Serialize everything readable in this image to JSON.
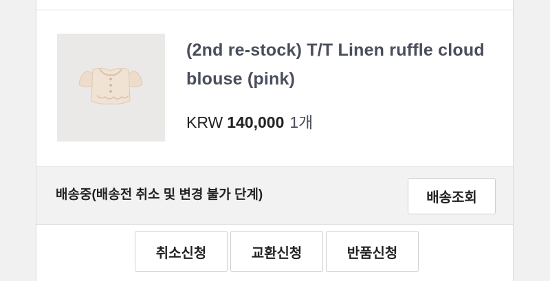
{
  "product": {
    "title": "(2nd re-stock) T/T Linen ruffle cloud blouse (pink)",
    "currency": "KRW",
    "price": "140,000",
    "quantity": "1개"
  },
  "status": {
    "text": "배송중(배송전 취소 및 변경 불가 단계)",
    "track_label": "배송조회"
  },
  "actions": {
    "cancel_label": "취소신청",
    "exchange_label": "교환신청",
    "return_label": "반품신청"
  }
}
